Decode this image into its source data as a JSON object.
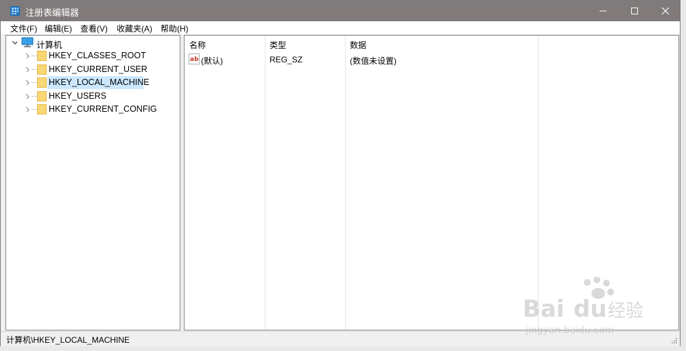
{
  "window": {
    "title": "注册表编辑器"
  },
  "menu": [
    "文件(F)",
    "编辑(E)",
    "查看(V)",
    "收藏夹(A)",
    "帮助(H)"
  ],
  "tree": {
    "root": "计算机",
    "children": [
      "HKEY_CLASSES_ROOT",
      "HKEY_CURRENT_USER",
      "HKEY_LOCAL_MACHINE",
      "HKEY_USERS",
      "HKEY_CURRENT_CONFIG"
    ],
    "selected": "HKEY_LOCAL_MACHINE"
  },
  "list": {
    "columns": [
      "名称",
      "类型",
      "数据"
    ],
    "rows": [
      {
        "name": "(默认)",
        "type": "REG_SZ",
        "data": "(数值未设置)"
      }
    ]
  },
  "status": {
    "path": "计算机\\HKEY_LOCAL_MACHINE"
  },
  "watermark": {
    "brand_text": "Baidu经验",
    "url_text": "jingyan.baidu.com"
  },
  "colors": {
    "titlebar": "#807b7a",
    "selection": "#cce8ff",
    "folder": "#f8d775"
  }
}
